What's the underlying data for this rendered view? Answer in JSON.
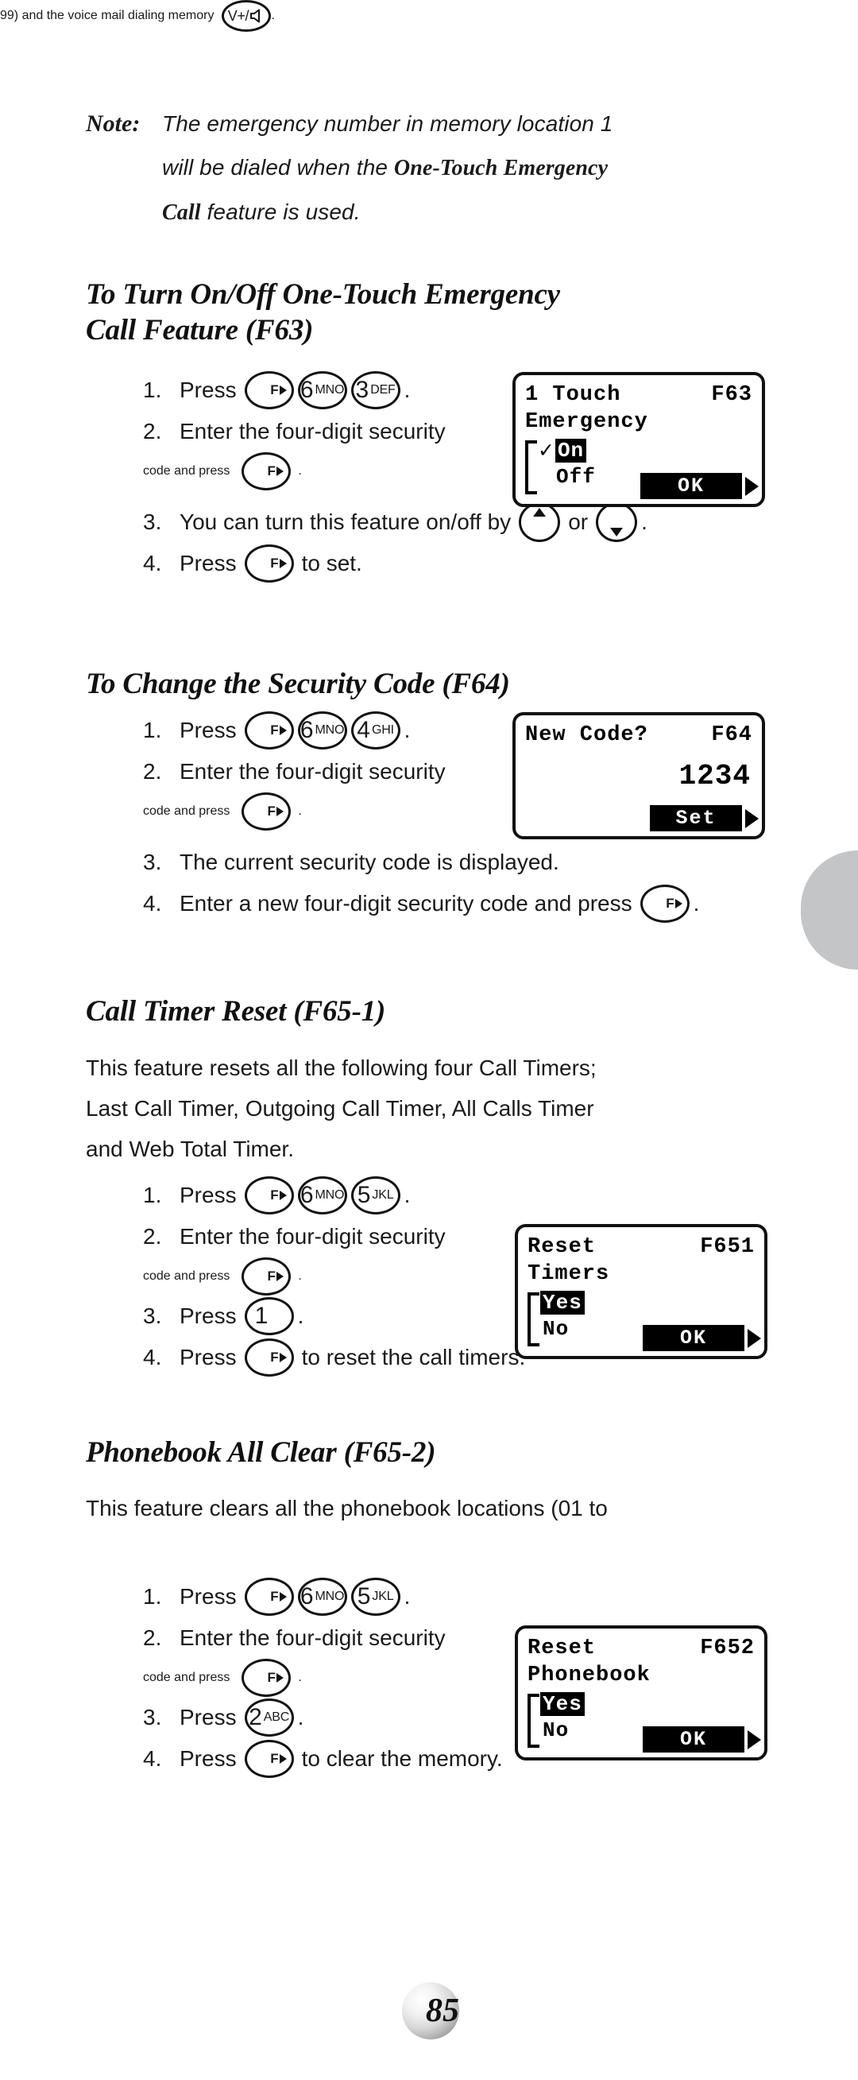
{
  "note": {
    "label": "Note:",
    "line1": "The emergency number in memory location 1",
    "line2_a": "will be dialed when the ",
    "line2_b": "One-Touch Emergency",
    "line3_a": "Call",
    "line3_b": " feature is used."
  },
  "sections": [
    {
      "id": "f63",
      "heading": "To Turn On/Off One-Touch Emergency\nCall Feature (F63)",
      "steps": [
        {
          "num": "1.",
          "pre": "Press",
          "keys": [
            "F▸",
            "6 MNO",
            "3 DEF"
          ],
          "post": "."
        },
        {
          "num": "2.",
          "pre": "Enter the four-digit security",
          "cont": "code and press",
          "keys": [
            "F▸"
          ],
          "post": "."
        },
        {
          "num": "3.",
          "pre": "You can turn this feature on/off by",
          "mid": "or",
          "post": "."
        },
        {
          "num": "4.",
          "pre": "Press",
          "keys": [
            "F▸"
          ],
          "post": "to set."
        }
      ],
      "lcd": {
        "title": "1 Touch",
        "code": "F63",
        "subtitle": "Emergency",
        "check": "✓",
        "option_selected": "On",
        "option_other": "Off",
        "softkey": "OK"
      }
    },
    {
      "id": "f64",
      "heading": "To Change the Security Code (F64)",
      "steps": [
        {
          "num": "1.",
          "pre": "Press",
          "keys": [
            "F▸",
            "6 MNO",
            "4 GHI"
          ],
          "post": "."
        },
        {
          "num": "2.",
          "pre": "Enter the four-digit security",
          "cont": "code and press",
          "keys": [
            "F▸"
          ],
          "post": "."
        },
        {
          "num": "3.",
          "pre": "The current security code is displayed."
        },
        {
          "num": "4.",
          "pre": "Enter a new four-digit security code and press",
          "keys": [
            "F▸"
          ],
          "post": "."
        }
      ],
      "lcd": {
        "title": "New Code?",
        "code": "F64",
        "value": "1234",
        "softkey": "Set"
      }
    },
    {
      "id": "f651",
      "heading": "Call Timer Reset (F65-1)",
      "paragraph_line1": "This feature resets all the following four Call Timers;",
      "paragraph_line2": "Last Call Timer, Outgoing Call Timer, All Calls Timer",
      "paragraph_line3": "and Web Total Timer.",
      "steps": [
        {
          "num": "1.",
          "pre": "Press",
          "keys": [
            "F▸",
            "6 MNO",
            "5 JKL"
          ],
          "post": "."
        },
        {
          "num": "2.",
          "pre": "Enter the four-digit security",
          "cont": "code and press",
          "keys": [
            "F▸"
          ],
          "post": "."
        },
        {
          "num": "3.",
          "pre": "Press",
          "keys": [
            "1"
          ],
          "post": "."
        },
        {
          "num": "4.",
          "pre": "Press",
          "keys": [
            "F▸"
          ],
          "post": "to reset the call timers."
        }
      ],
      "lcd": {
        "title": "Reset",
        "code": "F651",
        "subtitle": "Timers",
        "option_selected": "Yes",
        "option_other": "No",
        "softkey": "OK"
      }
    },
    {
      "id": "f652",
      "heading": "Phonebook All Clear (F65-2)",
      "paragraph_line1": "This feature clears all the phonebook locations (01 to",
      "paragraph_line2_a": "99) and the voice mail dialing memory",
      "paragraph_line2_b": ".",
      "steps": [
        {
          "num": "1.",
          "pre": "Press",
          "keys": [
            "F▸",
            "6 MNO",
            "5 JKL"
          ],
          "post": "."
        },
        {
          "num": "2.",
          "pre": "Enter the four-digit security",
          "cont": "code and press",
          "keys": [
            "F▸"
          ],
          "post": "."
        },
        {
          "num": "3.",
          "pre": "Press",
          "keys": [
            "2 ABC"
          ],
          "post": "."
        },
        {
          "num": "4.",
          "pre": "Press",
          "keys": [
            "F▸"
          ],
          "post": "to clear the memory."
        }
      ],
      "lcd": {
        "title": "Reset",
        "code": "F652",
        "subtitle": "Phonebook",
        "option_selected": "Yes",
        "option_other": "No",
        "softkey": "OK"
      }
    }
  ],
  "keys": {
    "f_label": "F",
    "six_digit": "6",
    "six_abc": "MNO",
    "three_digit": "3",
    "three_abc": "DEF",
    "four_digit": "4",
    "four_abc": "GHI",
    "five_digit": "5",
    "five_abc": "JKL",
    "two_digit": "2",
    "two_abc": "ABC",
    "one_digit": "1",
    "voicemail_label": "V+/"
  },
  "footer": {
    "page_number": "85"
  },
  "colors": {
    "ink": "#111111",
    "tab_gray": "#c3c5c7",
    "lcd_bg": "#ffffff"
  }
}
